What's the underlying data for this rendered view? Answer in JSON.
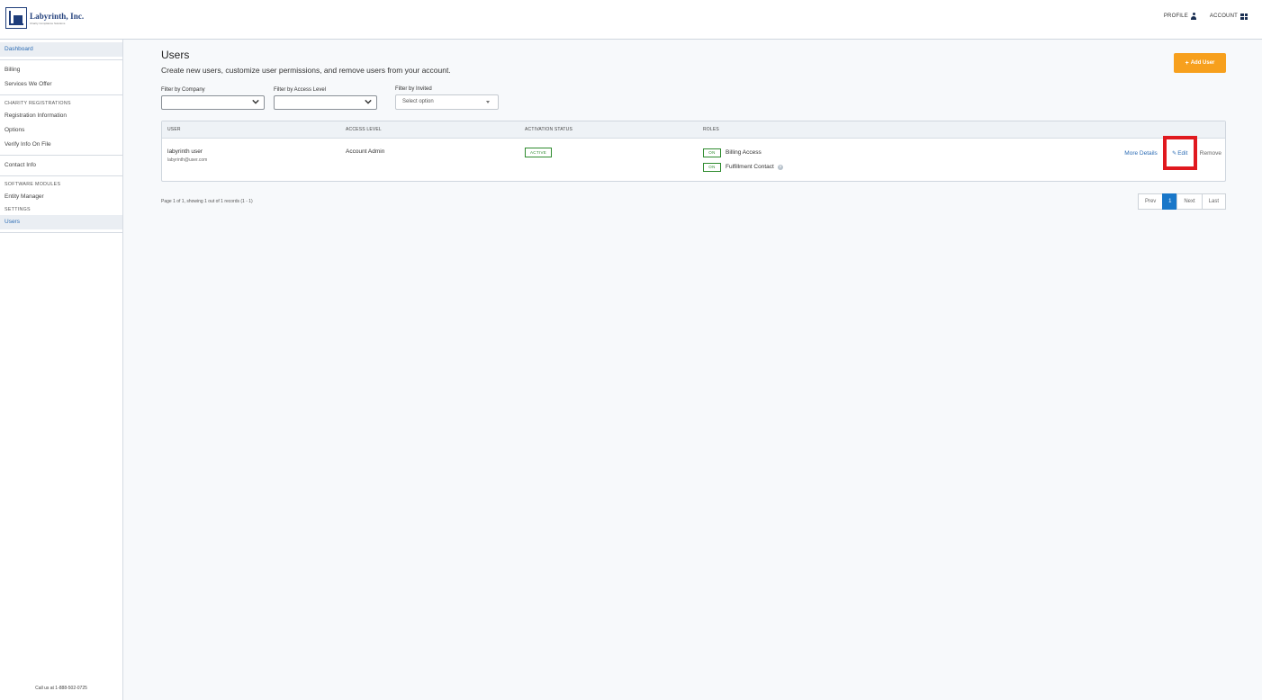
{
  "header": {
    "logo_name": "Labyrinth, Inc.",
    "logo_tagline": "Charity Compliance Solutions",
    "profile_label": "PROFILE",
    "account_label": "ACCOUNT"
  },
  "sidebar": {
    "items": [
      {
        "label": "Dashboard",
        "active": false
      },
      {
        "label": "Billing"
      },
      {
        "label": "Services We Offer"
      },
      {
        "label": "CHARITY REGISTRATIONS",
        "heading": true
      },
      {
        "label": "Registration Information"
      },
      {
        "label": "Options"
      },
      {
        "label": "Verify Info On File"
      },
      {
        "label": "Contact Info"
      },
      {
        "label": "SOFTWARE MODULES",
        "heading": true
      },
      {
        "label": "Entity Manager"
      },
      {
        "label": "SETTINGS",
        "heading": true
      },
      {
        "label": "Users",
        "active": true
      }
    ],
    "call_us": "Call us at 1-888-502-0725"
  },
  "main": {
    "title": "Users",
    "subtitle": "Create new users, customize user permissions, and remove users from your account.",
    "add_user_label": "Add User",
    "filters": {
      "company_label": "Filter by Company",
      "access_label": "Filter by Access Level",
      "invited_label": "Filter by Invited",
      "invited_value": "Select option"
    },
    "table": {
      "headers": [
        "USER",
        "ACCESS LEVEL",
        "ACTIVATION STATUS",
        "ROLES"
      ],
      "rows": [
        {
          "name": "labyrinth user",
          "email": "labyrinth@user.com",
          "access_level": "Account Admin",
          "status": "ACTIVE",
          "roles": [
            {
              "badge": "ON",
              "name": "Billing Access"
            },
            {
              "badge": "ON",
              "name": "Fulfillment Contact"
            }
          ],
          "actions": {
            "more": "More Details",
            "edit": "Edit",
            "remove": "Remove"
          }
        }
      ]
    },
    "pagination": {
      "info": "Page 1 of 1, showing 1 out of 1 records (1 - 1)",
      "prev": "Prev",
      "current": "1",
      "next": "Next",
      "last": "Last"
    }
  },
  "colors": {
    "accent": "#f7a01d",
    "link": "#2d6db5",
    "status_green": "#2e8b2e",
    "highlight_red": "#e0191f",
    "pager_active": "#1977c9"
  }
}
